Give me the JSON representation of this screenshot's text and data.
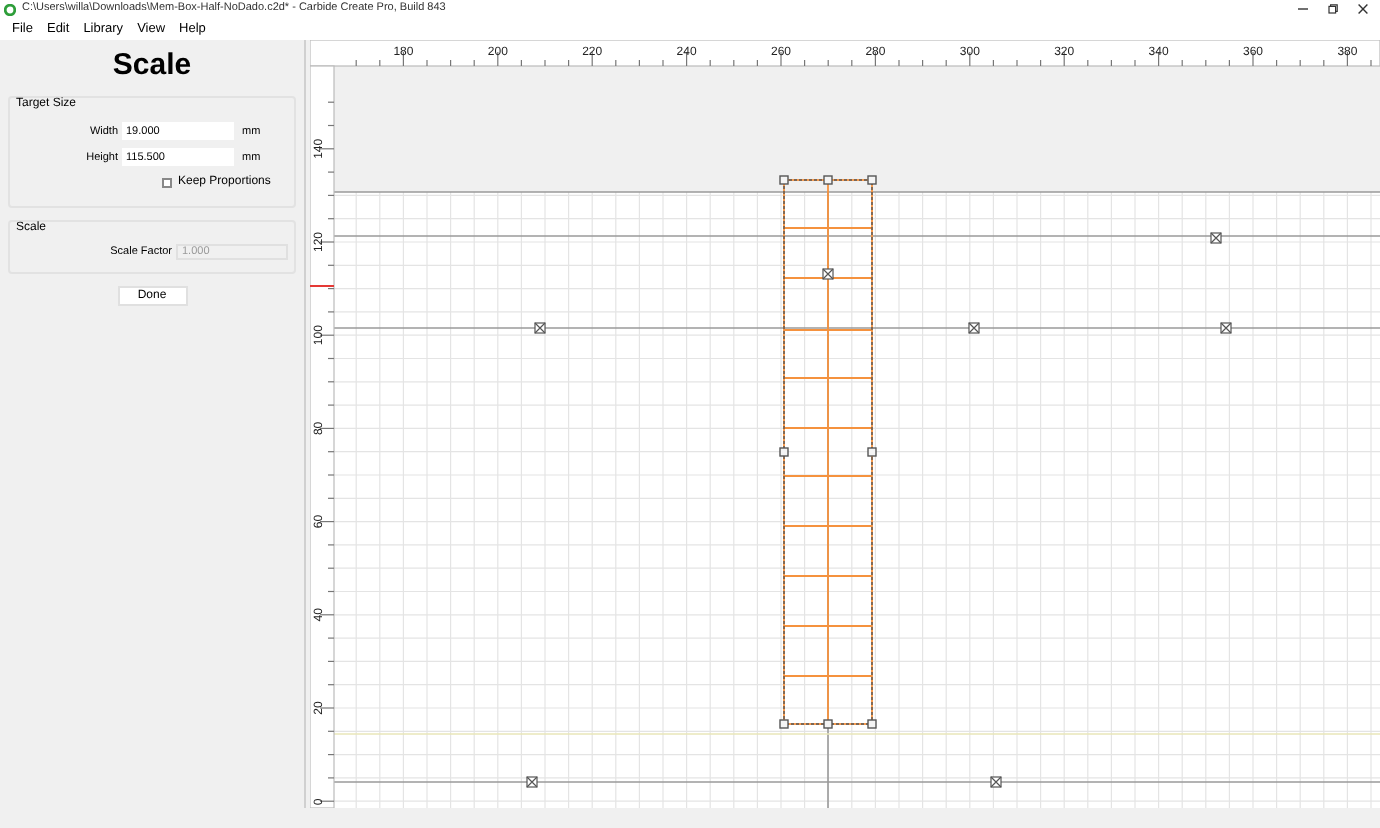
{
  "window": {
    "title": "C:\\Users\\willa\\Downloads\\Mem-Box-Half-NoDado.c2d* - Carbide Create Pro, Build 843"
  },
  "menu": [
    "File",
    "Edit",
    "Library",
    "View",
    "Help"
  ],
  "panel": {
    "heading": "Scale",
    "target_size": {
      "label": "Target Size",
      "fields": [
        {
          "label": "Width",
          "value": "19.000",
          "unit": "mm"
        },
        {
          "label": "Height",
          "value": "115.500",
          "unit": "mm"
        }
      ],
      "keep_proportions": {
        "label": "Keep Proportions",
        "checked": false
      }
    },
    "scale": {
      "label": "Scale",
      "field": {
        "label": "Scale Factor",
        "value": "1.000",
        "disabled": true
      }
    },
    "button": "Done"
  },
  "rulers": {
    "x_labels": [
      "180",
      "200",
      "220",
      "240",
      "260",
      "280",
      "300",
      "320",
      "340",
      "360",
      "380"
    ],
    "y_labels": [
      "140",
      "120",
      "100",
      "80",
      "60",
      "40",
      "20",
      "0"
    ]
  }
}
